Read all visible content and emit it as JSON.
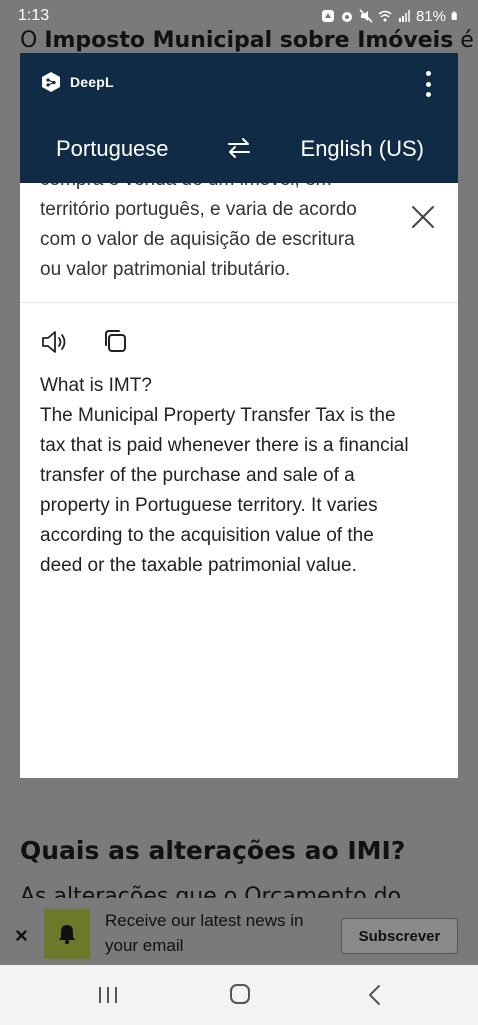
{
  "status_bar": {
    "time": "1:13",
    "battery": "81%"
  },
  "background_page": {
    "top_text_prefix": "O ",
    "top_text_bold": "Imposto Municipal sobre Imóveis",
    "top_text_suffix": " é",
    "heading": "Quais as alterações ao IMI?",
    "partial_text": "As alterações que o Orçamento do"
  },
  "deepl": {
    "brand": "DeepL",
    "source_lang": "Portuguese",
    "target_lang": "English (US)",
    "source_lines": [
      "compra e venda de um imóvel, em",
      "território português, e varia de acordo",
      "com o valor de aquisição de escritura",
      "ou valor patrimonial tributário."
    ],
    "translation_lines": [
      "What is IMT?",
      "The Municipal Property Transfer Tax is the",
      "tax that is paid whenever there is a financial",
      "transfer of the purchase and sale of a",
      "property in Portuguese territory. It varies",
      "according to the acquisition value of the",
      "deed or the taxable patrimonial value."
    ]
  },
  "subscribe": {
    "close": "×",
    "text": "Receive our latest news in your email",
    "button": "Subscrever"
  },
  "icons": {
    "brand": "deepl-logo-icon",
    "more": "more-vertical-icon",
    "swap": "swap-arrows-icon",
    "close": "close-icon",
    "speaker": "speaker-icon",
    "copy": "copy-icon",
    "bell": "bell-icon",
    "nav_recent": "recent-apps-icon",
    "nav_home": "home-icon",
    "nav_back": "back-icon"
  },
  "colors": {
    "deepl_header": "#0f2b46",
    "dim_overlay": "#7a7a7a",
    "bell_bg": "#6b7a2a"
  }
}
